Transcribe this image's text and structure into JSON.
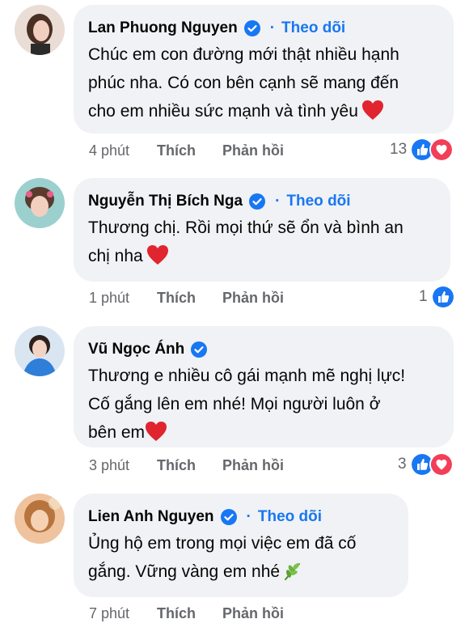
{
  "colors": {
    "link_blue": "#1877f2",
    "bubble_bg": "#f0f2f5",
    "meta_gray": "#65676b",
    "heart_red": "#f33e58"
  },
  "comments": [
    {
      "author": "Lan Phuong Nguyen",
      "verified": true,
      "follow_label": "Theo dõi",
      "separator": "·",
      "lines": [
        "Chúc em con đường mới thật nhiều hạnh",
        "phúc nha. Có con bên cạnh sẽ mang đến",
        "cho em nhiều sức mạnh và tình yêu"
      ],
      "emoji": "heart",
      "time": "4 phút",
      "like_label": "Thích",
      "reply_label": "Phản hồi",
      "reaction_count": "13",
      "reactions": [
        "like-icon",
        "love-icon"
      ]
    },
    {
      "author": "Nguyễn Thị Bích Nga",
      "verified": true,
      "follow_label": "Theo dõi",
      "separator": "·",
      "lines": [
        "Thương chị. Rồi mọi thứ sẽ ổn và bình an",
        "chị nha"
      ],
      "emoji": "heart",
      "time": "1 phút",
      "like_label": "Thích",
      "reply_label": "Phản hồi",
      "reaction_count": "1",
      "reactions": [
        "like-icon"
      ]
    },
    {
      "author": "Vũ Ngọc Ánh",
      "verified": true,
      "lines": [
        "Thương e nhiều cô gái mạnh mẽ nghị lực!",
        "Cố gắng lên em nhé! Mọi người luôn ở",
        "bên em"
      ],
      "emoji": "heart",
      "time": "3 phút",
      "like_label": "Thích",
      "reply_label": "Phản hồi",
      "reaction_count": "3",
      "reactions": [
        "like-icon",
        "love-icon"
      ]
    },
    {
      "author": "Lien Anh Nguyen",
      "verified": true,
      "follow_label": "Theo dõi",
      "separator": "·",
      "lines": [
        "Ủng hộ em trong mọi việc em đã cố",
        "gắng. Vững vàng em nhé"
      ],
      "emoji": "herb",
      "time": "7 phút",
      "like_label": "Thích",
      "reply_label": "Phản hồi"
    }
  ]
}
